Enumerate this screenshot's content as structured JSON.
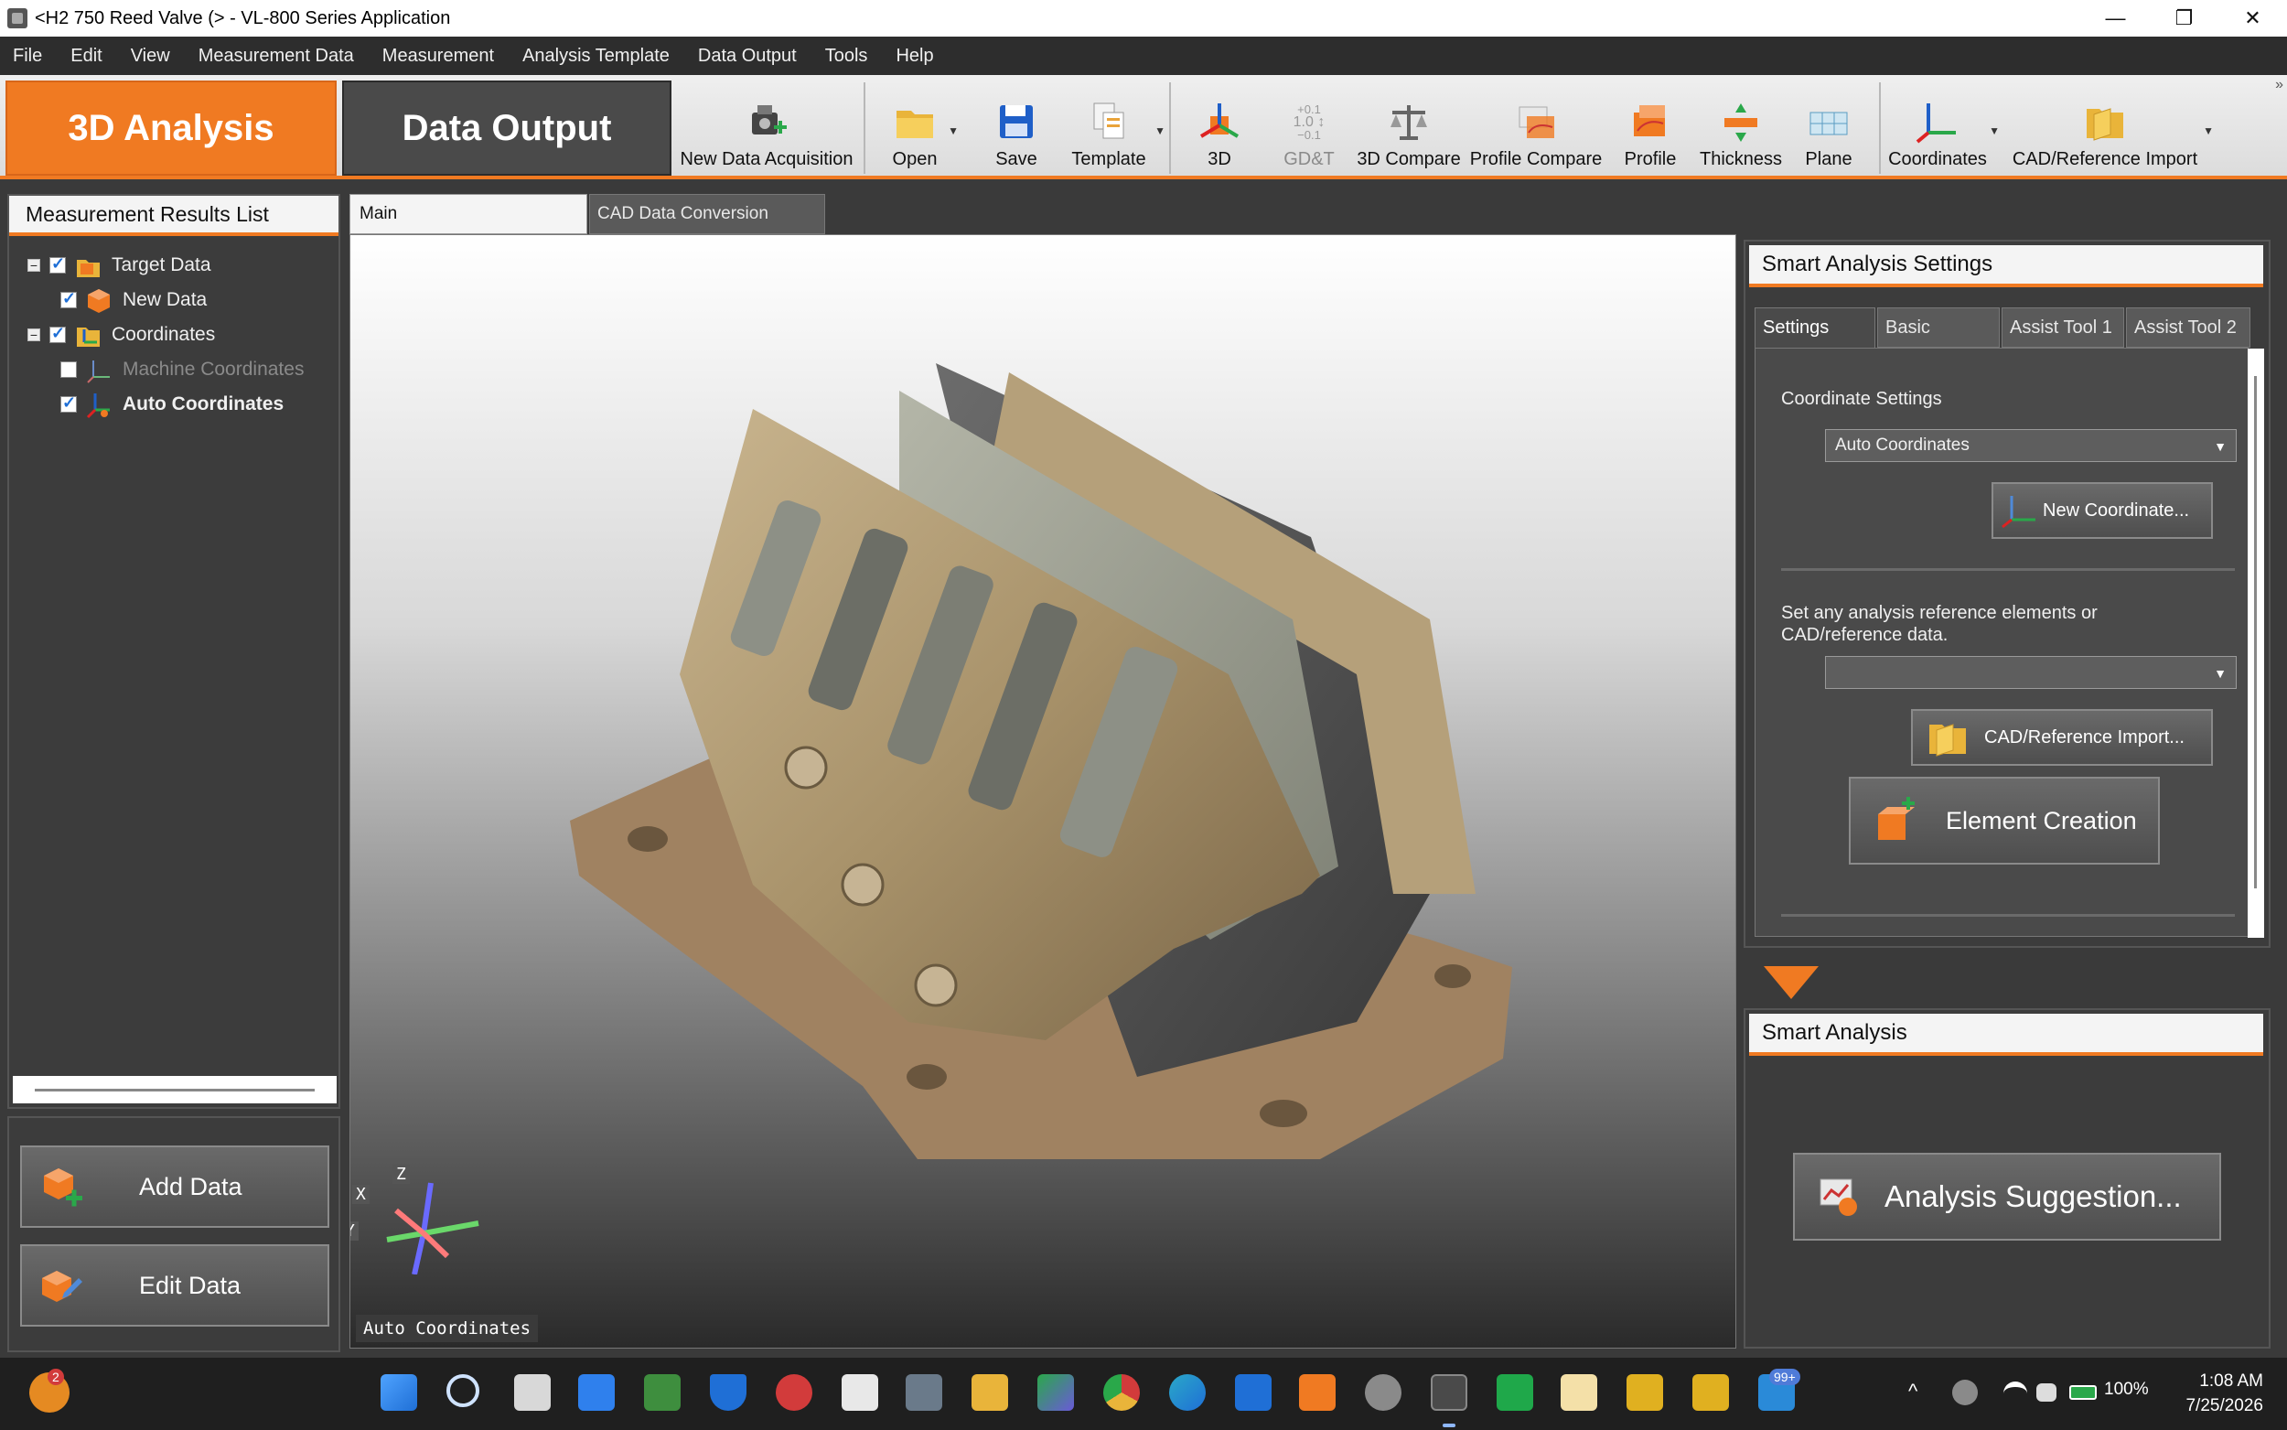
{
  "window": {
    "title": "<H2 750 Reed Valve (> - VL-800 Series Application",
    "controls": {
      "minimize": "—",
      "restore": "❐",
      "close": "✕"
    }
  },
  "menu": [
    "File",
    "Edit",
    "View",
    "Measurement Data",
    "Measurement",
    "Analysis Template",
    "Data Output",
    "Tools",
    "Help"
  ],
  "ribbon": {
    "mode_tabs": {
      "analysis": "3D Analysis",
      "output": "Data Output"
    },
    "tools": {
      "new_data": "New Data Acquisition",
      "open": "Open",
      "save": "Save",
      "template": "Template",
      "three_d": "3D",
      "gdt": "GD&T",
      "compare": "3D Compare",
      "profile_compare": "Profile Compare",
      "profile": "Profile",
      "thickness": "Thickness",
      "plane": "Plane",
      "coordinates": "Coordinates",
      "cad_import": "CAD/Reference Import"
    },
    "gdt_icon_text": {
      "top": "+0.1",
      "mid": "1.0 ↕",
      "bot": "−0.1"
    },
    "overflow": "»"
  },
  "left_panel": {
    "title": "Measurement Results List",
    "tree": {
      "target_data": "Target Data",
      "new_data": "New Data",
      "coordinates": "Coordinates",
      "machine_coordinates": "Machine Coordinates",
      "auto_coordinates": "Auto Coordinates"
    },
    "expander_symbol": "−",
    "add_data": "Add Data",
    "edit_data": "Edit Data"
  },
  "viewport": {
    "tabs": {
      "main": "Main",
      "cad": "CAD Data Conversion"
    },
    "coord_label": "Auto Coordinates",
    "axes": {
      "x": "X",
      "y": "Y",
      "z": "Z"
    }
  },
  "smart_settings": {
    "title": "Smart Analysis Settings",
    "tabs": {
      "settings": "Settings",
      "basic": "Basic",
      "assist1": "Assist Tool 1",
      "assist2": "Assist Tool 2"
    },
    "coordinate_settings_label": "Coordinate Settings",
    "coordinate_value": "Auto Coordinates",
    "new_coordinate": "New Coordinate...",
    "reference_hint_1": "Set any analysis reference elements or",
    "reference_hint_2": "CAD/reference data.",
    "reference_value": "",
    "cad_import": "CAD/Reference Import...",
    "element_creation": "Element Creation"
  },
  "smart_analysis": {
    "title": "Smart Analysis",
    "suggestion": "Analysis Suggestion..."
  },
  "taskbar": {
    "weather_badge": "2",
    "notif_badge": "99+",
    "battery": "100%",
    "time": "1:08 AM",
    "date": "7/25/2026",
    "chevron": "^"
  },
  "colors": {
    "accent": "#f07a22",
    "panel": "#3c3c3c",
    "dark": "#2d2d2d"
  }
}
